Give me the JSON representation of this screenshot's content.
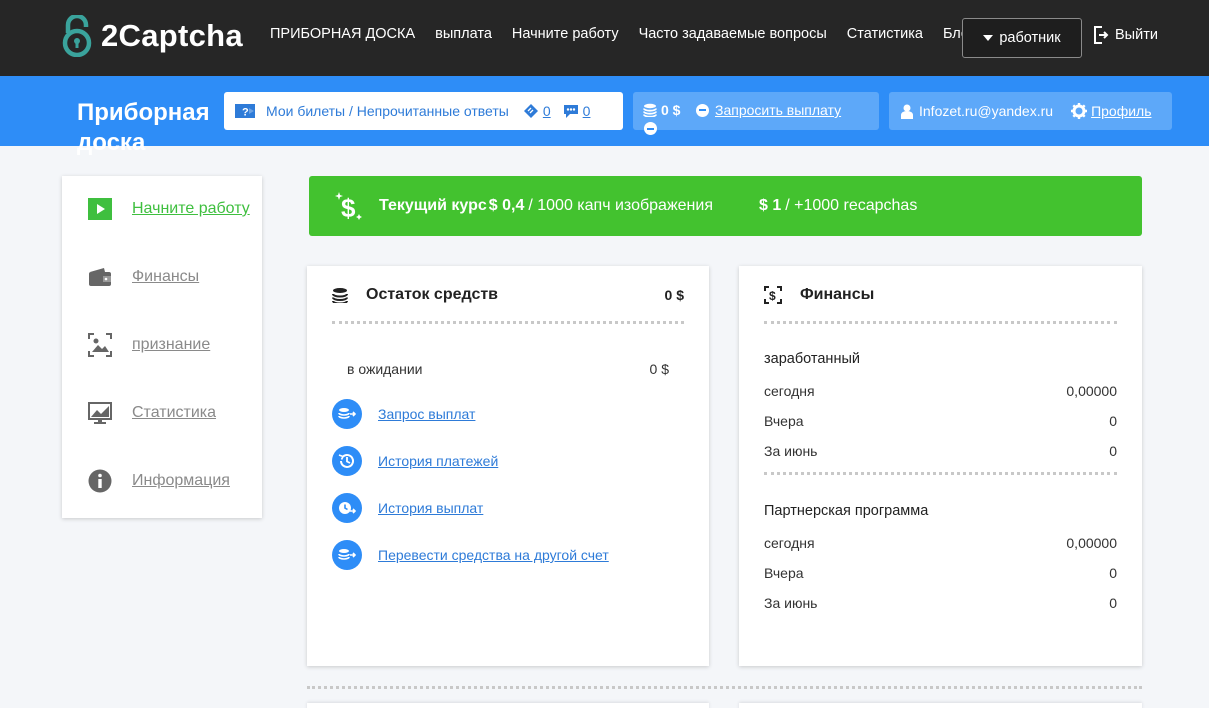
{
  "brand": {
    "name": "2Captcha"
  },
  "nav": {
    "links": [
      "ПРИБОРНАЯ ДОСКА",
      "выплата",
      "Начните работу",
      "Часто задаваемые вопросы",
      "Статистика",
      "Блог"
    ],
    "worker_label": "работник",
    "logout_label": "Выйти"
  },
  "header": {
    "title": "Приборная доска",
    "tickets_label": "Мои билеты / Непрочитанные ответы",
    "tickets_count": "0",
    "unread_count": "0",
    "balance": "0 $",
    "request_payout": "Запросить выплату",
    "email": "Infozet.ru@yandex.ru",
    "profile_label": "Профиль"
  },
  "sidebar": {
    "items": [
      {
        "label": "Начните работу",
        "icon": "play-icon",
        "active": true
      },
      {
        "label": "Финансы",
        "icon": "wallet-icon",
        "active": false
      },
      {
        "label": "признание",
        "icon": "image-recognition-icon",
        "active": false
      },
      {
        "label": "Статистика",
        "icon": "chart-monitor-icon",
        "active": false
      },
      {
        "label": "Информация",
        "icon": "info-icon",
        "active": false
      }
    ]
  },
  "rate": {
    "label": "Текущий курс",
    "image_rate": "$ 0,4",
    "image_unit": "/ 1000 капч изображения",
    "recaptcha_rate": "$ 1",
    "recaptcha_unit": "/ +1000 recapchas"
  },
  "balance_card": {
    "title": "Остаток средств",
    "value": "0 $",
    "pending_label": "в ожидании",
    "pending_value": "0 $",
    "links": [
      "Запрос выплат",
      "История платежей",
      "История выплат",
      "Перевести средства на другой счет"
    ]
  },
  "finance_card": {
    "title": "Финансы",
    "earned": {
      "title": "заработанный",
      "rows": [
        {
          "label": "сегодня",
          "value": "0,00000"
        },
        {
          "label": "Вчера",
          "value": "0"
        },
        {
          "label": "За июнь",
          "value": "0"
        }
      ]
    },
    "affiliate": {
      "title": "Партнерская программа",
      "rows": [
        {
          "label": "сегодня",
          "value": "0,00000"
        },
        {
          "label": "Вчера",
          "value": "0"
        },
        {
          "label": "За июнь",
          "value": "0"
        }
      ]
    }
  },
  "colors": {
    "nav_bg": "#262626",
    "blue": "#2e8df7",
    "green": "#43c22f",
    "teal_logo": "#3aa39c"
  }
}
